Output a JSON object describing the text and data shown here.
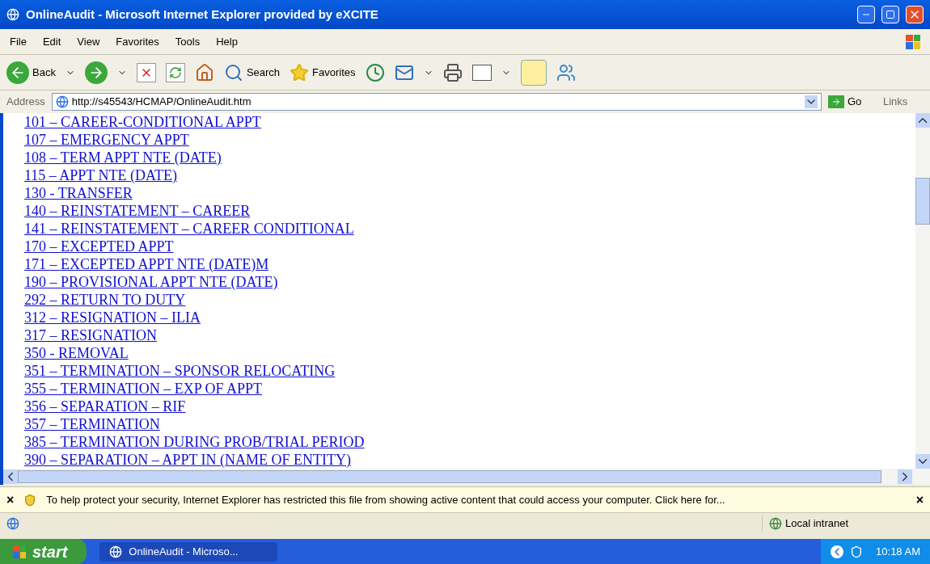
{
  "window": {
    "title": "OnlineAudit - Microsoft Internet Explorer provided by eXCITE"
  },
  "menu": [
    "File",
    "Edit",
    "View",
    "Favorites",
    "Tools",
    "Help"
  ],
  "toolbar": {
    "back": "Back",
    "search": "Search",
    "favorites": "Favorites"
  },
  "address": {
    "label": "Address",
    "value": "http://s45543/HCMAP/OnlineAudit.htm",
    "go": "Go",
    "links": "Links"
  },
  "links": [
    "101 – CAREER-CONDITIONAL APPT",
    "107 – EMERGENCY APPT",
    "108 – TERM APPT NTE (DATE)",
    "115 – APPT NTE (DATE)",
    "130 - TRANSFER",
    "140 – REINSTATEMENT – CAREER",
    "141 – REINSTATEMENT – CAREER CONDITIONAL",
    "170 – EXCEPTED APPT",
    "171 – EXCEPTED APPT NTE (DATE)M",
    "190 – PROVISIONAL APPT NTE (DATE)",
    "292 – RETURN TO DUTY",
    "312 – RESIGNATION – ILIA",
    "317 – RESIGNATION",
    "350 - REMOVAL",
    "351 – TERMINATION – SPONSOR RELOCATING",
    "355 – TERMINATION – EXP OF APPT",
    "356 – SEPARATION – RIF",
    "357 – TERMINATION",
    "385 – TERMINATION DURING PROB/TRIAL PERIOD",
    "390 – SEPARATION – APPT IN (NAME OF ENTITY)"
  ],
  "info_bar": {
    "close": "×",
    "message": "To help protect your security, Internet Explorer has restricted this file from showing active content that could access your computer. Click here for...",
    "dismiss": "×"
  },
  "status_bar": {
    "zone": "Local intranet"
  },
  "taskbar": {
    "start": "start",
    "task": "OnlineAudit - Microso...",
    "clock": "10:18 AM"
  }
}
